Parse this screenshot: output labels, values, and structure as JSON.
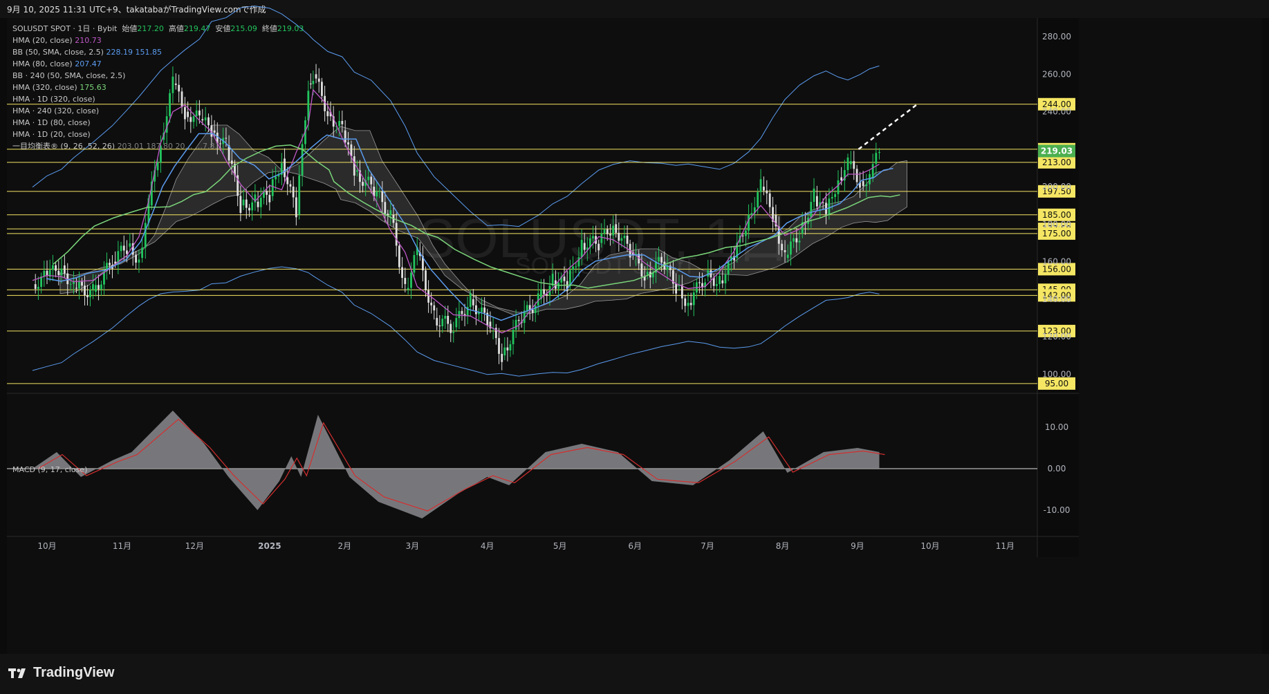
{
  "header": {
    "caption": "9月 10, 2025 11:31 UTC+9、takatabaがTradingView.comで作成"
  },
  "watermark": {
    "symbol": "SOLUSDT, 1日",
    "sub": "SOLUSDT SPOT"
  },
  "legend": {
    "symbol_line": "SOLUSDT SPOT · 1日 · Bybit",
    "ohlc": {
      "open_label": "始値",
      "open": "217.20",
      "high_label": "高値",
      "high": "219.47",
      "low_label": "安値",
      "low": "215.09",
      "close_label": "終値",
      "close": "219.03"
    },
    "indicators": [
      {
        "name": "HMA (20, close)",
        "value": "210.73"
      },
      {
        "name": "BB (50, SMA, close, 2.5)",
        "value": "228.19  151.85"
      },
      {
        "name": "HMA (80, close)",
        "value": "207.47"
      },
      {
        "name": "BB · 240 (50, SMA, close, 2.5)",
        "value": ""
      },
      {
        "name": "HMA (320, close)",
        "value": "175.63"
      },
      {
        "name": "HMA · 1D (320, close)",
        "value": ""
      },
      {
        "name": "HMA · 240 (320, close)",
        "value": ""
      },
      {
        "name": "HMA · 1D (80, close)",
        "value": ""
      },
      {
        "name": "HMA · 1D (20, close)",
        "value": ""
      },
      {
        "name": "一目均衡表® (9, 26, 52, 26)",
        "value": "203.01  187.80  20… …7.8…"
      }
    ]
  },
  "macd_label": "MACD (9, 17, close)",
  "footer": {
    "brand": "TradingView"
  },
  "colors": {
    "up": "#22c55e",
    "down": "#e0e0e0",
    "hma20": "#c058c8",
    "bb": "#5b9cf0",
    "hma80": "#5b9cf0",
    "hma320": "#7bd67b",
    "hline": "#f5e663",
    "macd": "#d32f2f",
    "hist": "#8a8a8e",
    "price_tag": "#4caf50"
  },
  "chart_data": [
    {
      "type": "line",
      "title": "SOLUSDT SPOT · 1日 · Bybit",
      "price_scale": {
        "ticks": [
          100,
          120,
          140,
          160,
          180,
          200,
          220,
          240,
          260,
          280
        ],
        "ylim": [
          90,
          292
        ]
      },
      "x_ticks": [
        "10月",
        "11月",
        "12月",
        "2025",
        "2月",
        "3月",
        "4月",
        "5月",
        "6月",
        "7月",
        "8月",
        "9月",
        "10月",
        "11月"
      ],
      "horizontal_levels": [
        "244.00",
        "220.00",
        "213.00",
        "197.50",
        "185.00",
        "177.50",
        "175.00",
        "156.00",
        "145.00",
        "142.00",
        "123.00",
        "95.00"
      ],
      "last_price": "219.03",
      "close_series": [
        {
          "x": "2024-09-25",
          "y": 148
        },
        {
          "x": "2024-10-01",
          "y": 152
        },
        {
          "x": "2024-10-07",
          "y": 158
        },
        {
          "x": "2024-10-12",
          "y": 146
        },
        {
          "x": "2024-10-20",
          "y": 144
        },
        {
          "x": "2024-10-28",
          "y": 160
        },
        {
          "x": "2024-11-03",
          "y": 168
        },
        {
          "x": "2024-11-08",
          "y": 162
        },
        {
          "x": "2024-11-12",
          "y": 190
        },
        {
          "x": "2024-11-17",
          "y": 225
        },
        {
          "x": "2024-11-22",
          "y": 255
        },
        {
          "x": "2024-11-27",
          "y": 240
        },
        {
          "x": "2024-12-03",
          "y": 236
        },
        {
          "x": "2024-12-08",
          "y": 230
        },
        {
          "x": "2024-12-14",
          "y": 222
        },
        {
          "x": "2024-12-20",
          "y": 190
        },
        {
          "x": "2024-12-26",
          "y": 192
        },
        {
          "x": "2025-01-01",
          "y": 195
        },
        {
          "x": "2025-01-06",
          "y": 215
        },
        {
          "x": "2025-01-12",
          "y": 185
        },
        {
          "x": "2025-01-17",
          "y": 255
        },
        {
          "x": "2025-01-19",
          "y": 260
        },
        {
          "x": "2025-01-25",
          "y": 240
        },
        {
          "x": "2025-01-31",
          "y": 230
        },
        {
          "x": "2025-02-05",
          "y": 208
        },
        {
          "x": "2025-02-12",
          "y": 200
        },
        {
          "x": "2025-02-20",
          "y": 185
        },
        {
          "x": "2025-02-26",
          "y": 145
        },
        {
          "x": "2025-03-03",
          "y": 165
        },
        {
          "x": "2025-03-10",
          "y": 130
        },
        {
          "x": "2025-03-18",
          "y": 125
        },
        {
          "x": "2025-03-25",
          "y": 140
        },
        {
          "x": "2025-04-01",
          "y": 128
        },
        {
          "x": "2025-04-07",
          "y": 110
        },
        {
          "x": "2025-04-14",
          "y": 128
        },
        {
          "x": "2025-04-22",
          "y": 140
        },
        {
          "x": "2025-04-28",
          "y": 150
        },
        {
          "x": "2025-05-04",
          "y": 147
        },
        {
          "x": "2025-05-10",
          "y": 170
        },
        {
          "x": "2025-05-17",
          "y": 170
        },
        {
          "x": "2025-05-23",
          "y": 180
        },
        {
          "x": "2025-05-30",
          "y": 165
        },
        {
          "x": "2025-06-05",
          "y": 153
        },
        {
          "x": "2025-06-12",
          "y": 160
        },
        {
          "x": "2025-06-18",
          "y": 147
        },
        {
          "x": "2025-06-23",
          "y": 138
        },
        {
          "x": "2025-06-30",
          "y": 152
        },
        {
          "x": "2025-07-06",
          "y": 150
        },
        {
          "x": "2025-07-12",
          "y": 162
        },
        {
          "x": "2025-07-18",
          "y": 185
        },
        {
          "x": "2025-07-23",
          "y": 200
        },
        {
          "x": "2025-07-28",
          "y": 185
        },
        {
          "x": "2025-08-02",
          "y": 162
        },
        {
          "x": "2025-08-08",
          "y": 175
        },
        {
          "x": "2025-08-14",
          "y": 195
        },
        {
          "x": "2025-08-19",
          "y": 185
        },
        {
          "x": "2025-08-24",
          "y": 205
        },
        {
          "x": "2025-08-28",
          "y": 212
        },
        {
          "x": "2025-09-02",
          "y": 203
        },
        {
          "x": "2025-09-06",
          "y": 205
        },
        {
          "x": "2025-09-10",
          "y": 219
        }
      ]
    },
    {
      "type": "area",
      "title": "MACD (9, 17, close)",
      "y_ticks": [
        "10.00",
        "0.00",
        "-10.00"
      ],
      "ylim": [
        -14,
        15
      ],
      "histogram": [
        {
          "x": "2024-09-25",
          "y": 0
        },
        {
          "x": "2024-10-05",
          "y": 4
        },
        {
          "x": "2024-10-15",
          "y": -2
        },
        {
          "x": "2024-10-28",
          "y": 2
        },
        {
          "x": "2024-11-05",
          "y": 4
        },
        {
          "x": "2024-11-22",
          "y": 14
        },
        {
          "x": "2024-12-05",
          "y": 6
        },
        {
          "x": "2024-12-15",
          "y": -2
        },
        {
          "x": "2024-12-27",
          "y": -10
        },
        {
          "x": "2025-01-05",
          "y": -3
        },
        {
          "x": "2025-01-10",
          "y": 3
        },
        {
          "x": "2025-01-14",
          "y": -2
        },
        {
          "x": "2025-01-21",
          "y": 13
        },
        {
          "x": "2025-02-03",
          "y": -2
        },
        {
          "x": "2025-02-15",
          "y": -8
        },
        {
          "x": "2025-03-05",
          "y": -12
        },
        {
          "x": "2025-03-20",
          "y": -6
        },
        {
          "x": "2025-04-01",
          "y": -2
        },
        {
          "x": "2025-04-10",
          "y": -4
        },
        {
          "x": "2025-04-25",
          "y": 4
        },
        {
          "x": "2025-05-10",
          "y": 6
        },
        {
          "x": "2025-05-25",
          "y": 4
        },
        {
          "x": "2025-06-08",
          "y": -3
        },
        {
          "x": "2025-06-25",
          "y": -4
        },
        {
          "x": "2025-07-10",
          "y": 2
        },
        {
          "x": "2025-07-24",
          "y": 9
        },
        {
          "x": "2025-08-03",
          "y": -1
        },
        {
          "x": "2025-08-18",
          "y": 4
        },
        {
          "x": "2025-09-01",
          "y": 5
        },
        {
          "x": "2025-09-10",
          "y": 4
        }
      ]
    }
  ]
}
